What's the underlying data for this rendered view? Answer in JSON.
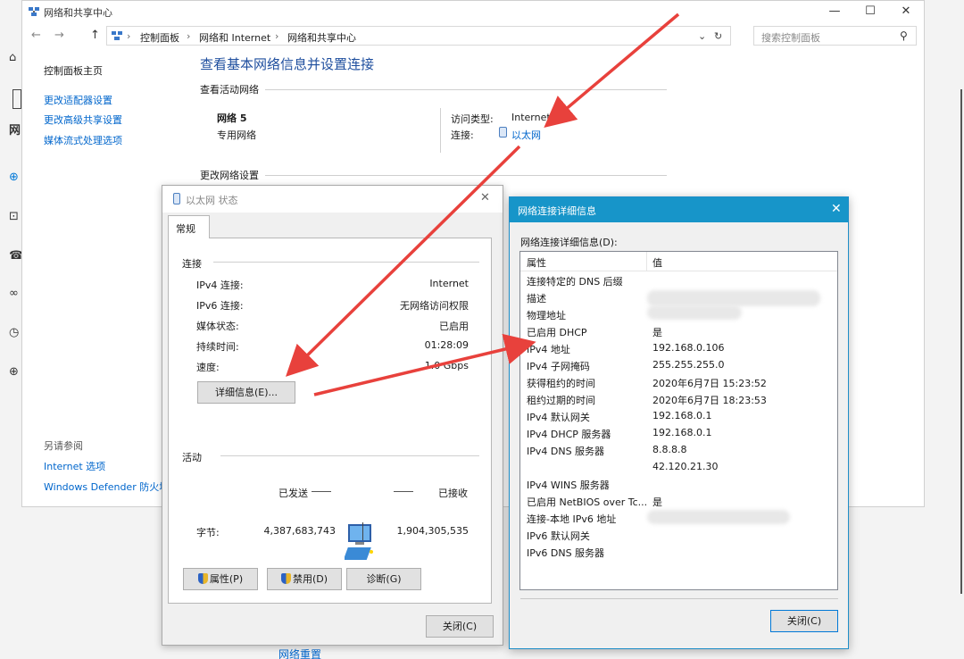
{
  "main_window": {
    "title": "网络和共享中心",
    "controls": {
      "minimize": "—",
      "maximize": "☐",
      "close": "✕"
    },
    "breadcrumb": [
      "控制面板",
      "网络和 Internet",
      "网络和共享中心"
    ],
    "search_placeholder": "搜索控制面板",
    "sidebar": {
      "home": "控制面板主页",
      "links": [
        "更改适配器设置",
        "更改高级共享设置",
        "媒体流式处理选项"
      ],
      "see_also_title": "另请参阅",
      "see_also": [
        "Internet 选项",
        "Windows Defender 防火墙"
      ]
    },
    "content": {
      "title": "查看基本网络信息并设置连接",
      "active_networks_header": "查看活动网络",
      "network_name": "网络 5",
      "network_type": "专用网络",
      "access_type_label": "访问类型:",
      "access_type_value": "Internet",
      "connections_label": "连接:",
      "connections_value": "以太网",
      "change_settings_header": "更改网络设置"
    }
  },
  "background": {
    "bottom_link": "网络重置"
  },
  "status_dialog": {
    "title": "以太网 状态",
    "tab": "常规",
    "connection_header": "连接",
    "rows": [
      {
        "label": "IPv4 连接:",
        "value": "Internet"
      },
      {
        "label": "IPv6 连接:",
        "value": "无网络访问权限"
      },
      {
        "label": "媒体状态:",
        "value": "已启用"
      },
      {
        "label": "持续时间:",
        "value": "01:28:09"
      },
      {
        "label": "速度:",
        "value": "1.0 Gbps"
      }
    ],
    "details_button": "详细信息(E)...",
    "activity_header": "活动",
    "sent_label": "已发送",
    "received_label": "已接收",
    "bytes_label": "字节:",
    "bytes_sent": "4,387,683,743",
    "bytes_received": "1,904,305,535",
    "properties_button": "属性(P)",
    "disable_button": "禁用(D)",
    "diagnose_button": "诊断(G)",
    "close_button": "关闭(C)"
  },
  "details_dialog": {
    "title": "网络连接详细信息",
    "caption": "网络连接详细信息(D):",
    "col_property": "属性",
    "col_value": "值",
    "rows": [
      {
        "p": "连接特定的 DNS 后缀",
        "v": ""
      },
      {
        "p": "描述",
        "v": ""
      },
      {
        "p": "物理地址",
        "v": ""
      },
      {
        "p": "已启用 DHCP",
        "v": "是"
      },
      {
        "p": "IPv4 地址",
        "v": "192.168.0.106"
      },
      {
        "p": "IPv4 子网掩码",
        "v": "255.255.255.0"
      },
      {
        "p": "获得租约的时间",
        "v": "2020年6月7日 15:23:52"
      },
      {
        "p": "租约过期的时间",
        "v": "2020年6月7日 18:23:53"
      },
      {
        "p": "IPv4 默认网关",
        "v": "192.168.0.1"
      },
      {
        "p": "IPv4 DHCP 服务器",
        "v": "192.168.0.1"
      },
      {
        "p": "IPv4 DNS 服务器",
        "v": "8.8.8.8"
      },
      {
        "p": "",
        "v": "42.120.21.30"
      },
      {
        "p": "IPv4 WINS 服务器",
        "v": ""
      },
      {
        "p": "已启用 NetBIOS over Tc...",
        "v": "是"
      },
      {
        "p": "连接-本地 IPv6 地址",
        "v": ""
      },
      {
        "p": "IPv6 默认网关",
        "v": ""
      },
      {
        "p": "IPv6 DNS 服务器",
        "v": ""
      }
    ],
    "close_button": "关闭(C)"
  },
  "colors": {
    "accent_blue": "#1795c9",
    "link_blue": "#0066cc",
    "title_blue": "#1e4e9e",
    "arrow_red": "#e8413c"
  }
}
